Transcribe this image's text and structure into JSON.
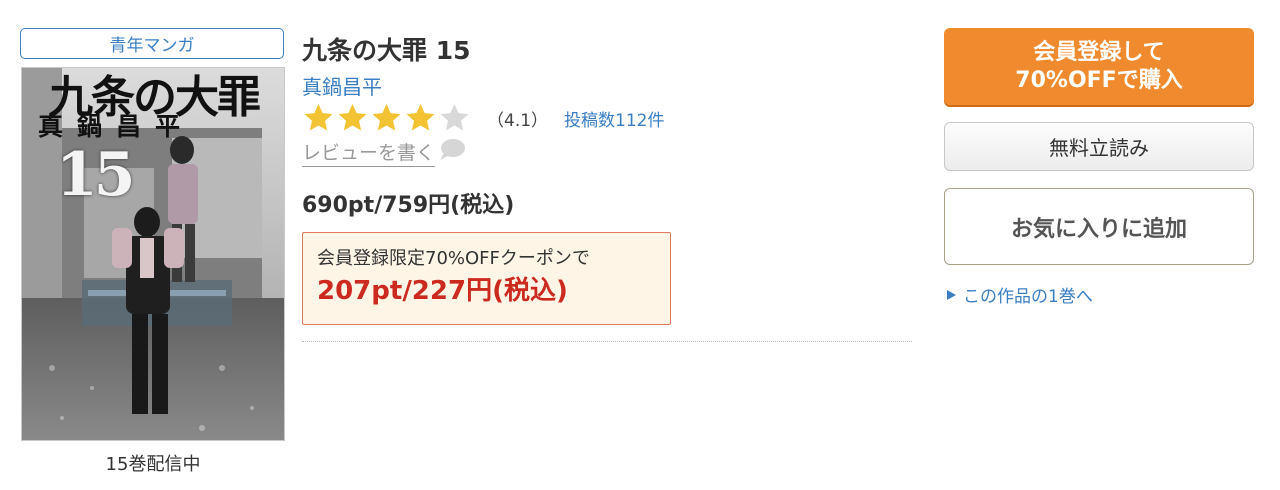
{
  "genre": {
    "label": "青年マンガ"
  },
  "cover": {
    "title": "九条の大罪",
    "author": "真鍋昌平",
    "volume": "15"
  },
  "volume_status": "15巻配信中",
  "book": {
    "title": "九条の大罪 15",
    "author": "真鍋昌平",
    "rating": {
      "stars_filled": 4,
      "stars_total": 5,
      "value_text": "（4.1）",
      "review_count_text": "投稿数112件"
    },
    "write_review_label": "レビューを書く",
    "price_text": "690pt/759円(税込)"
  },
  "coupon": {
    "label": "会員登録限定70%OFFクーポンで",
    "price_text": "207pt/227円(税込)"
  },
  "actions": {
    "buy_line1": "会員登録して",
    "buy_line2": "70%OFFで購入",
    "trial_label": "無料立読み",
    "favorite_label": "お気に入りに追加",
    "first_volume_link": "この作品の1巻へ"
  },
  "colors": {
    "accent_blue": "#3a7fc4",
    "buy_orange": "#ef8a2e",
    "star_gold": "#f3c334",
    "star_empty": "#d9d9d9",
    "coupon_red": "#cc2a1f"
  },
  "icons": [
    "star-icon",
    "speech-bubble-icon",
    "triangle-right-icon"
  ]
}
